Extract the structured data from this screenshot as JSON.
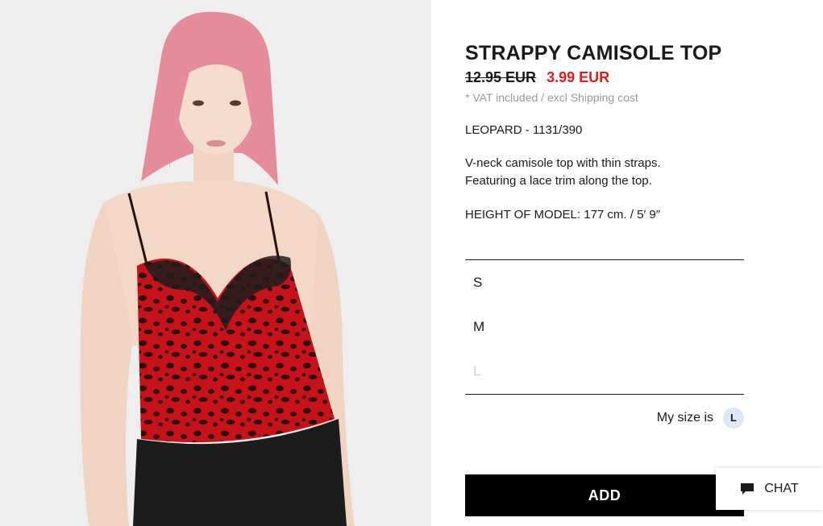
{
  "product": {
    "title": "STRAPPY CAMISOLE TOP",
    "old_price": "12.95 EUR",
    "sale_price": "3.99 EUR",
    "vat_note": "* VAT included / excl Shipping cost",
    "color_ref": "LEOPARD - 1131/390",
    "description_line1": "V-neck camisole top with thin straps.",
    "description_line2": "Featuring a lace trim along the top.",
    "model_height": "HEIGHT OF MODEL: 177 cm. / 5′ 9″",
    "photo_icon": "product-photo"
  },
  "sizes": [
    {
      "label": "S",
      "available": true
    },
    {
      "label": "M",
      "available": true
    },
    {
      "label": "L",
      "available": false
    }
  ],
  "my_size": {
    "label": "My size is",
    "value": "L"
  },
  "actions": {
    "add_label": "ADD",
    "chat_label": "CHAT",
    "chat_icon": "chat-bubble-icon"
  },
  "colors": {
    "sale_red": "#e41b1b",
    "button_black": "#000000",
    "badge_blue": "#dce8f5",
    "photo_bg": "#eeeeee"
  }
}
